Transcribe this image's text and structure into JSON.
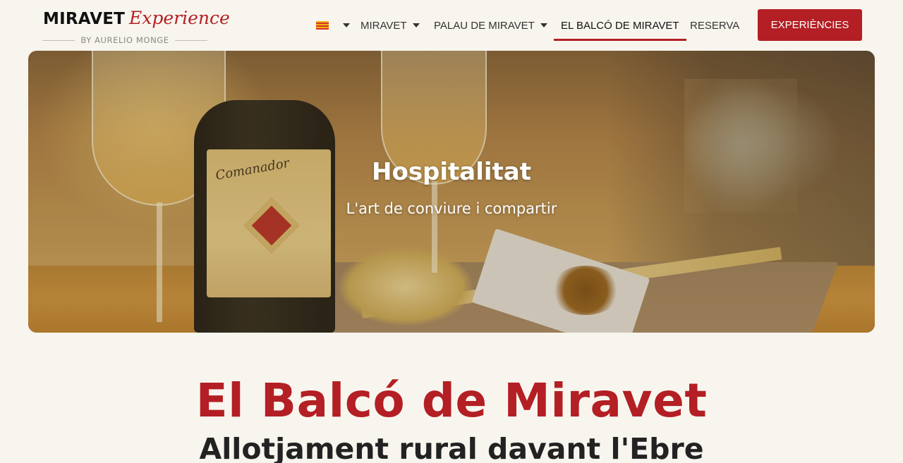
{
  "logo": {
    "main": "MIRAVET",
    "script": "Experience",
    "byline": "BY AURELIO MONGE"
  },
  "nav": {
    "language_icon": "catalan-flag-icon",
    "items": [
      {
        "label": "MIRAVET",
        "has_dropdown": true
      },
      {
        "label": "PALAU DE MIRAVET",
        "has_dropdown": true
      },
      {
        "label": "EL BALCÓ DE MIRAVET",
        "has_dropdown": false,
        "active": true
      },
      {
        "label": "RESERVA",
        "has_dropdown": false
      }
    ],
    "cta_label": "EXPERIÈNCIES"
  },
  "hero": {
    "title": "Hospitalitat",
    "subtitle": "L'art de conviure i compartir",
    "bottle_label": "Comanador"
  },
  "main": {
    "title": "El Balcó de Miravet",
    "subtitle": "Allotjament rural davant l'Ebre"
  },
  "colors": {
    "accent": "#b31f24",
    "background": "#f8f5ee",
    "text": "#1a1a1a"
  }
}
